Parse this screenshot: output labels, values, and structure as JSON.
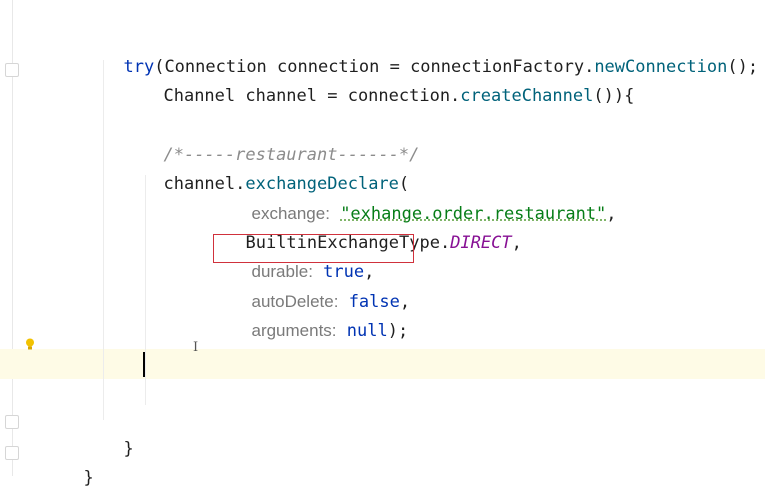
{
  "code": {
    "l1": {
      "kw": "try",
      "rest": "(Connection connection = connectionFactory.",
      "method": "newConnection",
      "tail": "();"
    },
    "l2": {
      "pre": "Channel channel = connection.",
      "method": "createChannel",
      "tail": "()){"
    },
    "l3": {
      "comment": "/*-----restaurant------*/"
    },
    "l4": {
      "pre": "channel.",
      "method": "exchangeDeclare",
      "tail": "("
    },
    "l5": {
      "hint": "exchange:",
      "str": "\"exhange.order.restaurant\"",
      "tail": ","
    },
    "l6": {
      "pre": "BuiltinExchangeType.",
      "const": "DIRECT",
      "tail": ","
    },
    "l7": {
      "hint": "durable:",
      "lit": "true",
      "tail": ","
    },
    "l8": {
      "hint": "autoDelete:",
      "lit": "false",
      "tail": ","
    },
    "l9": {
      "hint": "arguments:",
      "lit": "null",
      "tail": ");"
    },
    "l10": {
      "text": "}"
    },
    "l11": {
      "text": "}"
    }
  },
  "icons": {
    "fold": "fold-marker-icon",
    "bulb": "lightbulb-icon",
    "cursor": "text-cursor-icon"
  },
  "colors": {
    "highlight_box": "#d0313c",
    "caret_line": "#fefbe6"
  }
}
